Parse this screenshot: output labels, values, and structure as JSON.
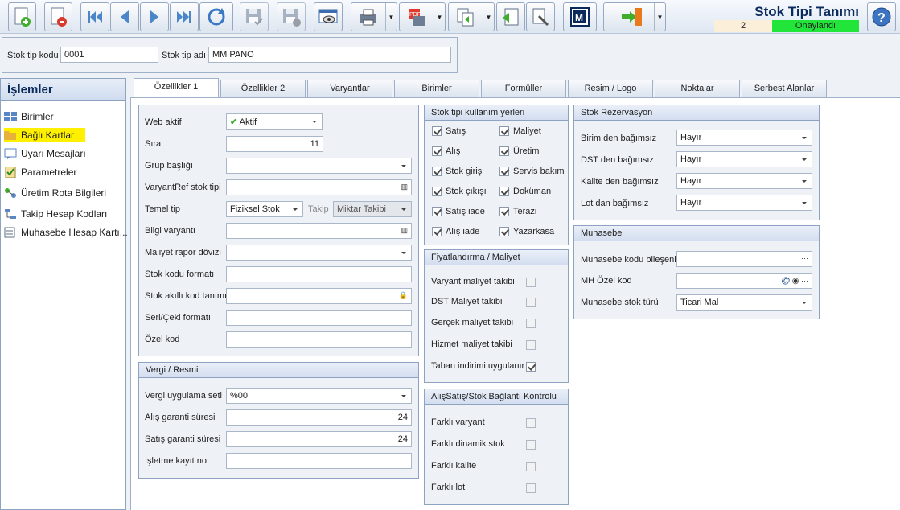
{
  "window": {
    "title": "Stok Tipi Tanımı",
    "record_number": "2",
    "status": "Onaylandı"
  },
  "header": {
    "code_label": "Stok tip kodu",
    "code_value": "0001",
    "name_label": "Stok tip adı",
    "name_value": "MM PANO"
  },
  "sidebar": {
    "title": "İşlemler",
    "items": [
      {
        "label": "Birimler",
        "icon": "grid-icon"
      },
      {
        "label": "Bağlı Kartlar",
        "icon": "folder-icon",
        "selected": true
      },
      {
        "label": "Uyarı Mesajları",
        "icon": "message-icon"
      },
      {
        "label": "Parametreler",
        "icon": "checklist-icon"
      },
      {
        "label": "Üretim Rota Bilgileri",
        "icon": "route-icon"
      },
      {
        "label": "Takip Hesap Kodları",
        "icon": "tree-icon"
      },
      {
        "label": "Muhasebe Hesap Kartı...",
        "icon": "ledger-icon"
      }
    ]
  },
  "tabs": [
    "Özellikler 1",
    "Özellikler 2",
    "Varyantlar",
    "Birimler",
    "Formüller",
    "Resim / Logo",
    "Noktalar",
    "Serbest Alanlar"
  ],
  "general": {
    "web_aktif_label": "Web aktif",
    "web_aktif_value": "Aktif",
    "sira_label": "Sıra",
    "sira_value": "11",
    "grup_label": "Grup başlığı",
    "grup_value": "",
    "varyantref_label": "VaryantRef stok tipi",
    "varyantref_value": "",
    "temel_tip_label": "Temel tip",
    "temel_tip_value": "Fiziksel Stok",
    "takip_label": "Takip",
    "takip_value": "Miktar Takibi",
    "bilgi_varyanti_label": "Bilgi varyantı",
    "bilgi_varyanti_value": "",
    "maliyet_doviz_label": "Maliyet rapor dövizi",
    "maliyet_doviz_value": "",
    "stok_kodu_formati_label": "Stok kodu formatı",
    "stok_kodu_formati_value": "",
    "akilli_kod_label": "Stok akıllı kod tanımı",
    "akilli_kod_value": "",
    "seri_ceki_label": "Seri/Çeki formatı",
    "seri_ceki_value": "",
    "ozel_kod_label": "Özel kod",
    "ozel_kod_value": ""
  },
  "vergi": {
    "title": "Vergi / Resmi",
    "uygulama_label": "Vergi uygulama seti",
    "uygulama_value": "%00",
    "alis_garanti_label": "Alış garanti süresi",
    "alis_garanti_value": "24",
    "satis_garanti_label": "Satış garanti süresi",
    "satis_garanti_value": "24",
    "isletme_label": "İşletme kayıt no",
    "isletme_value": ""
  },
  "kullanim": {
    "title": "Stok tipi kullanım yerleri",
    "left": [
      {
        "label": "Satış",
        "checked": true
      },
      {
        "label": "Alış",
        "checked": true
      },
      {
        "label": "Stok girişi",
        "checked": true
      },
      {
        "label": "Stok çıkışı",
        "checked": true
      },
      {
        "label": "Satış iade",
        "checked": true
      },
      {
        "label": "Alış iade",
        "checked": true
      }
    ],
    "right": [
      {
        "label": "Maliyet",
        "checked": true
      },
      {
        "label": "Üretim",
        "checked": true
      },
      {
        "label": "Servis bakım",
        "checked": true
      },
      {
        "label": "Doküman",
        "checked": true
      },
      {
        "label": "Terazi",
        "checked": true
      },
      {
        "label": "Yazarkasa",
        "checked": true
      }
    ]
  },
  "fiyat": {
    "title": "Fiyatlandırma / Maliyet",
    "items": [
      {
        "label": "Varyant maliyet takibi",
        "checked": false
      },
      {
        "label": "DST Maliyet takibi",
        "checked": false
      },
      {
        "label": "Gerçek maliyet takibi",
        "checked": false
      },
      {
        "label": "Hizmet maliyet takibi",
        "checked": false
      },
      {
        "label": "Taban indirimi uygulanır",
        "checked": true
      }
    ]
  },
  "baglanti": {
    "title": "AlışSatış/Stok Bağlantı Kontrolu",
    "items": [
      {
        "label": "Farklı varyant",
        "checked": false
      },
      {
        "label": "Farklı dinamik stok",
        "checked": false
      },
      {
        "label": "Farklı kalite",
        "checked": false
      },
      {
        "label": "Farklı lot",
        "checked": false
      }
    ]
  },
  "rezervasyon": {
    "title": "Stok Rezervasyon",
    "items": [
      {
        "label": "Birim den bağımsız",
        "value": "Hayır"
      },
      {
        "label": "DST den bağımsız",
        "value": "Hayır"
      },
      {
        "label": "Kalite den bağımsız",
        "value": "Hayır"
      },
      {
        "label": "Lot dan bağımsız",
        "value": "Hayır"
      }
    ]
  },
  "muhasebe": {
    "title": "Muhasebe",
    "bileseni_label": "Muhasebe kodu bileşeni",
    "bileseni_value": "",
    "mh_ozel_label": "MH Özel kod",
    "mh_ozel_value": "",
    "stok_turu_label": "Muhasebe stok türü",
    "stok_turu_value": "Ticari Mal"
  },
  "colors": {
    "accent": "#0b2a5c",
    "approved": "#22e53a",
    "highlight": "#fff000"
  }
}
